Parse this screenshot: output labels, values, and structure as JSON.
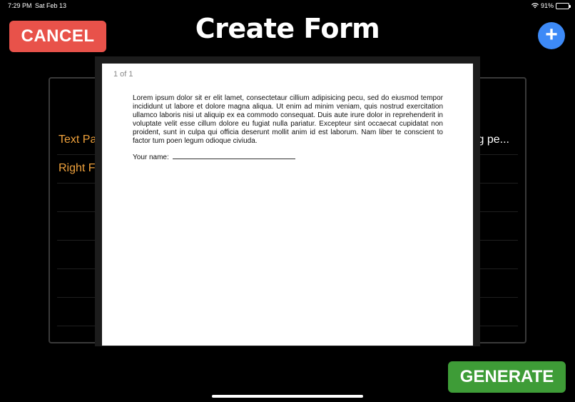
{
  "status_bar": {
    "time": "7:29 PM",
    "date": "Sat Feb 13",
    "battery": "91%",
    "battery_level": 0.91
  },
  "header": {
    "cancel_label": "CANCEL",
    "title": "Create Form",
    "add_label": "+"
  },
  "form_rows": [
    {
      "label": "Text Par",
      "value": "ng pe..."
    },
    {
      "label": "Right Fi",
      "value": ""
    }
  ],
  "preview": {
    "page_counter": "1 of 1",
    "body": "Lorem ipsum dolor sit er elit lamet, consectetaur cillium adipisicing pecu, sed do eiusmod tempor incididunt ut labore et dolore magna aliqua. Ut enim ad minim veniam, quis nostrud exercitation ullamco laboris nisi ut aliquip ex ea commodo consequat. Duis aute irure dolor in reprehenderit in voluptate velit esse cillum dolore eu fugiat nulla pariatur. Excepteur sint occaecat cupidatat non proident, sunt in culpa qui officia deserunt mollit anim id est laborum. Nam liber te conscient to factor tum poen legum odioque civiuda.",
    "name_label": "Your name:"
  },
  "footer": {
    "generate_label": "GENERATE"
  },
  "colors": {
    "cancel": "#e8524a",
    "add": "#3d8af7",
    "generate": "#3e9c37",
    "row_label": "#f0a23c"
  }
}
